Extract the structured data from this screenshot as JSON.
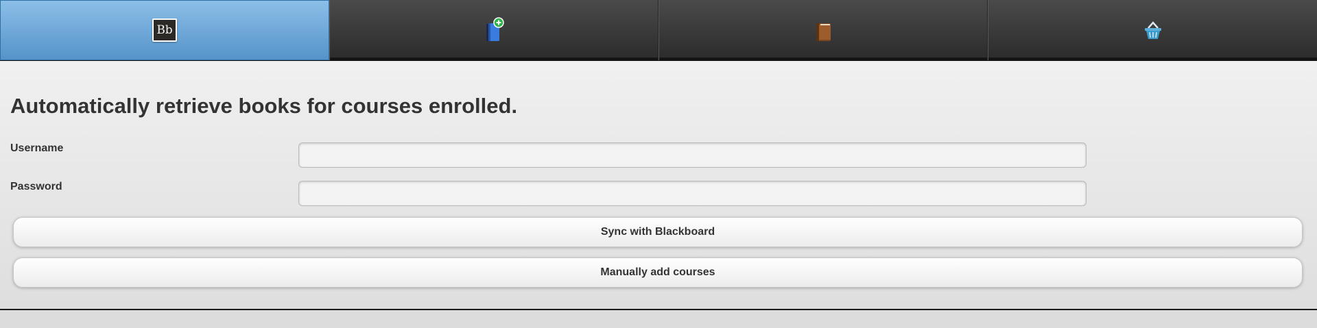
{
  "nav": {
    "tabs": [
      {
        "name": "blackboard",
        "icon": "blackboard-logo-icon",
        "icon_text": "Bb",
        "active": true
      },
      {
        "name": "add-book",
        "icon": "add-book-icon",
        "active": false
      },
      {
        "name": "my-books",
        "icon": "books-icon",
        "active": false
      },
      {
        "name": "basket",
        "icon": "shopping-basket-icon",
        "active": false
      }
    ],
    "active_color": "#5f9fd6"
  },
  "main": {
    "heading": "Automatically retrieve books for courses enrolled.",
    "username_label": "Username",
    "username_value": "",
    "password_label": "Password",
    "password_value": "",
    "sync_button": "Sync with Blackboard",
    "manual_button": "Manually add courses"
  }
}
